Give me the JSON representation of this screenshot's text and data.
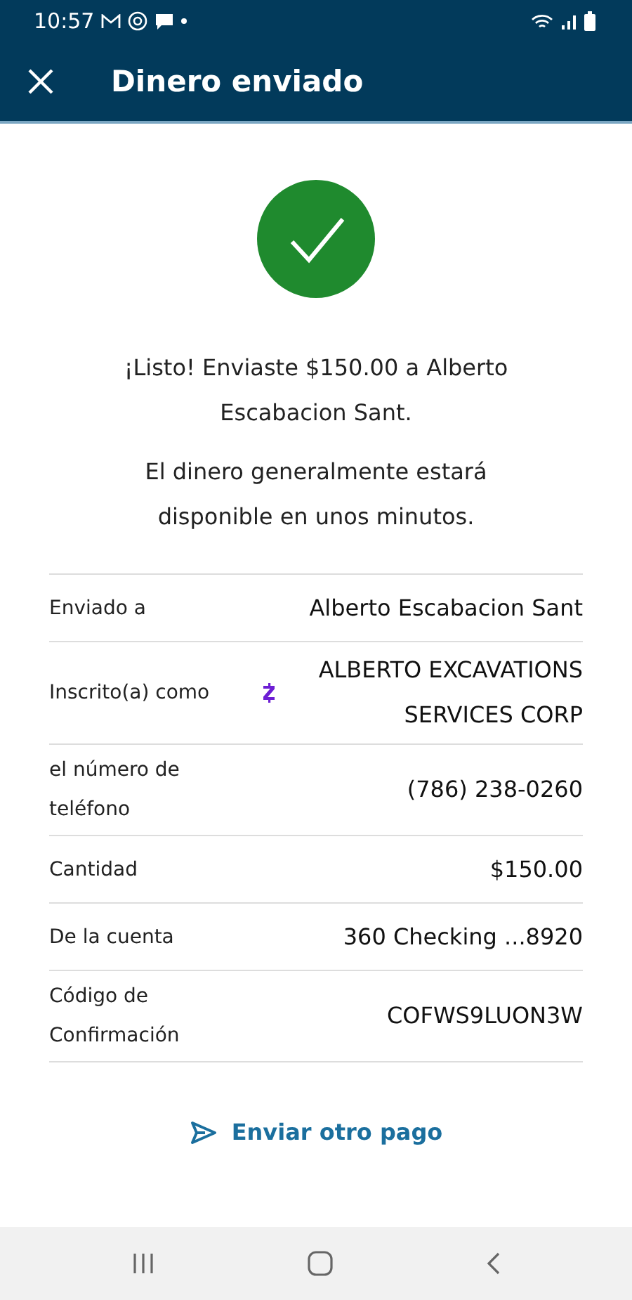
{
  "status_bar": {
    "time": "10:57"
  },
  "header": {
    "title": "Dinero enviado"
  },
  "message": {
    "primary": "¡Listo! Enviaste $150.00 a Alberto Escabacion Sant.",
    "secondary": "El dinero generalmente estará disponible en unos minutos."
  },
  "details": [
    {
      "kind": "plain",
      "label": "Enviado a",
      "value": "Alberto Escabacion Sant"
    },
    {
      "kind": "zelle",
      "label": "Inscrito(a) como",
      "value": "ALBERTO EXCAVATIONS SERVICES CORP"
    },
    {
      "kind": "plain",
      "label": "el número de teléfono",
      "value": "(786) 238-0260"
    },
    {
      "kind": "plain",
      "label": "Cantidad",
      "value": "$150.00"
    },
    {
      "kind": "plain",
      "label": "De la cuenta",
      "value": "360 Checking ...8920"
    },
    {
      "kind": "plain",
      "label": "Código de Confirmación",
      "value": "COFWS9LUON3W"
    }
  ],
  "action": {
    "label": "Enviar otro pago"
  }
}
